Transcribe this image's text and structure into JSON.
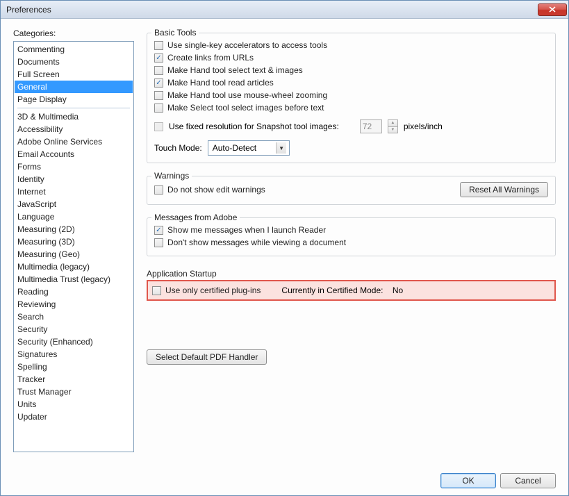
{
  "window": {
    "title": "Preferences"
  },
  "categories_label": "Categories:",
  "categories_group1": [
    "Commenting",
    "Documents",
    "Full Screen",
    "General",
    "Page Display"
  ],
  "categories_group2": [
    "3D & Multimedia",
    "Accessibility",
    "Adobe Online Services",
    "Email Accounts",
    "Forms",
    "Identity",
    "Internet",
    "JavaScript",
    "Language",
    "Measuring (2D)",
    "Measuring (3D)",
    "Measuring (Geo)",
    "Multimedia (legacy)",
    "Multimedia Trust (legacy)",
    "Reading",
    "Reviewing",
    "Search",
    "Security",
    "Security (Enhanced)",
    "Signatures",
    "Spelling",
    "Tracker",
    "Trust Manager",
    "Units",
    "Updater"
  ],
  "selected_category": "General",
  "basic_tools": {
    "title": "Basic Tools",
    "opts": [
      {
        "label": "Use single-key accelerators to access tools",
        "checked": false
      },
      {
        "label": "Create links from URLs",
        "checked": true
      },
      {
        "label": "Make Hand tool select text & images",
        "checked": false
      },
      {
        "label": "Make Hand tool read articles",
        "checked": true
      },
      {
        "label": "Make Hand tool use mouse-wheel zooming",
        "checked": false
      },
      {
        "label": "Make Select tool select images before text",
        "checked": false
      }
    ],
    "snapshot": {
      "label": "Use fixed resolution for Snapshot tool images:",
      "value": "72",
      "unit": "pixels/inch",
      "checked": false
    },
    "touch": {
      "label": "Touch Mode:",
      "value": "Auto-Detect"
    }
  },
  "warnings": {
    "title": "Warnings",
    "opt": {
      "label": "Do not show edit warnings",
      "checked": false
    },
    "reset_btn": "Reset All Warnings"
  },
  "messages": {
    "title": "Messages from Adobe",
    "opts": [
      {
        "label": "Show me messages when I launch Reader",
        "checked": true
      },
      {
        "label": "Don't show messages while viewing a document",
        "checked": false
      }
    ]
  },
  "app_startup": {
    "title": "Application Startup",
    "opt": {
      "label": "Use only certified plug-ins",
      "checked": false
    },
    "cert_label": "Currently in Certified Mode:",
    "cert_value": "No",
    "handler_btn": "Select Default PDF Handler"
  },
  "footer": {
    "ok": "OK",
    "cancel": "Cancel"
  }
}
